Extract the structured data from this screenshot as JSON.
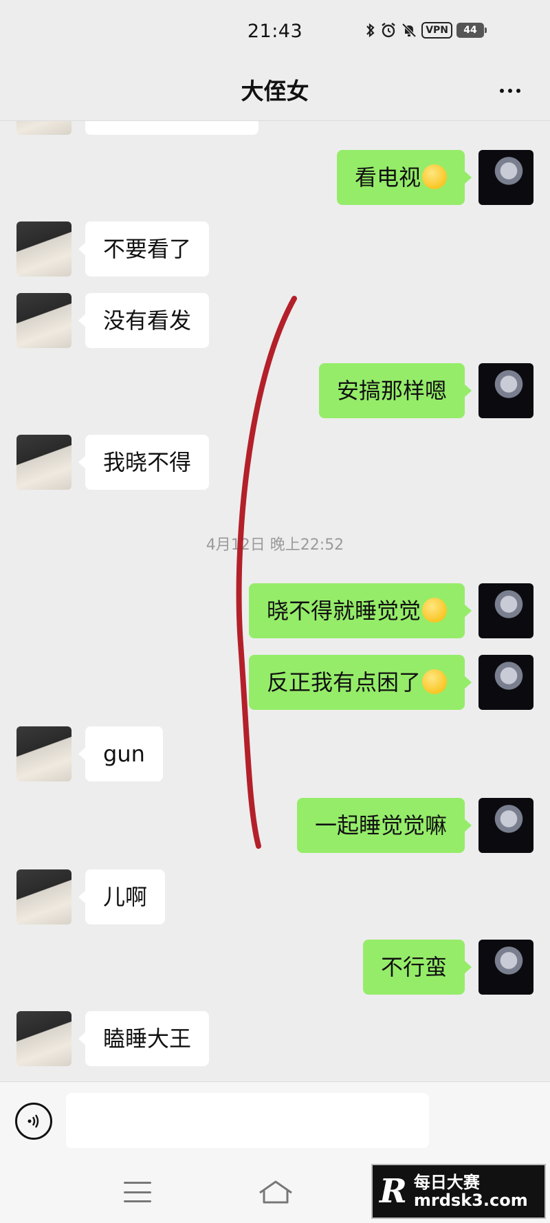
{
  "status_bar": {
    "time": "21:43",
    "vpn_label": "VPN",
    "battery": "44",
    "icons": [
      "bluetooth-icon",
      "alarm-icon",
      "mute-bell-icon",
      "vpn-icon",
      "battery-icon"
    ]
  },
  "header": {
    "title": "大侄女",
    "more_icon": "more-icon"
  },
  "colors": {
    "background": "#ededed",
    "self_bubble": "#95ec69",
    "other_bubble": "#ffffff",
    "annotation": "#b3202a"
  },
  "messages": [
    {
      "sender": "me",
      "text": "看电视",
      "emoji": "grin"
    },
    {
      "sender": "them",
      "text": "不要看了"
    },
    {
      "sender": "them",
      "text": "没有看发"
    },
    {
      "sender": "me",
      "text": "安搞那样嗯"
    },
    {
      "sender": "them",
      "text": "我晓不得"
    },
    {
      "sender": "timestamp",
      "text": "4月12日 晚上22:52"
    },
    {
      "sender": "me",
      "text": "晓不得就睡觉觉",
      "emoji": "tears-of-joy"
    },
    {
      "sender": "me",
      "text": "反正我有点困了",
      "emoji": "rolling-laugh"
    },
    {
      "sender": "them",
      "text": "gun"
    },
    {
      "sender": "me",
      "text": "一起睡觉觉嘛"
    },
    {
      "sender": "them",
      "text": "儿啊"
    },
    {
      "sender": "me",
      "text": "不行蛮"
    },
    {
      "sender": "them",
      "text": "瞌睡大王"
    }
  ],
  "input": {
    "placeholder": "",
    "voice_icon": "voice-icon"
  },
  "nav": {
    "icons": [
      "menu-icon",
      "home-icon"
    ]
  },
  "watermark": {
    "logo": "R",
    "title": "每日大赛",
    "url": "mrdsk3.com"
  }
}
